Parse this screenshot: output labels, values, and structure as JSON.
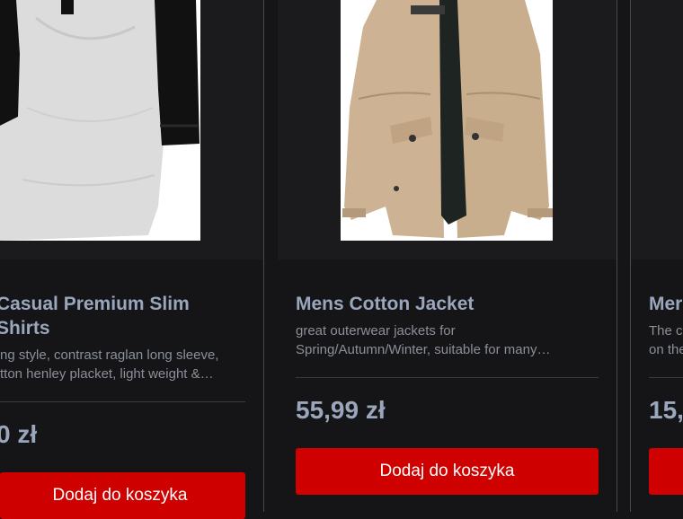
{
  "products": [
    {
      "title_line1": "Casual Premium Slim",
      "title_line2": "Shirts",
      "desc_line1": "ng style, contrast raglan long sleeve,",
      "desc_line2": "tton henley placket, light weight &…",
      "price": "0 zł",
      "button_label": "Dodaj do koszyka"
    },
    {
      "title_line1": "Mens Cotton Jacket",
      "desc_line1": "great outerwear jackets for",
      "desc_line2": "Spring/Autumn/Winter, suitable for many…",
      "price": "55,99 zł",
      "button_label": "Dodaj do koszyka"
    },
    {
      "title_line1": "Mer",
      "desc_line1": "The c",
      "desc_line2": "on the",
      "price": "15,",
      "button_label": ""
    }
  ],
  "colors": {
    "background": "#151517",
    "image_area": "#1b1b1d",
    "title": "#9aa6bc",
    "description": "#8a8f99",
    "button": "#cf0000"
  },
  "icons": {
    "product_1": "raglan-shirt-image",
    "product_2": "cotton-jacket-image",
    "product_3": "product-image-partial"
  }
}
